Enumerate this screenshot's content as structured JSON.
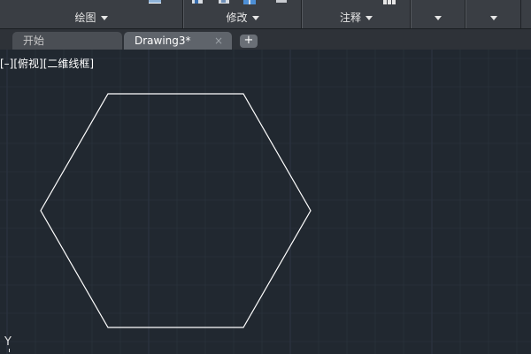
{
  "ribbon": {
    "panels": [
      {
        "label": "绘图",
        "has_dropdown": true
      },
      {
        "label": "修改",
        "has_dropdown": true
      },
      {
        "label": "注释",
        "has_dropdown": true
      },
      {
        "label": "",
        "has_dropdown": true
      },
      {
        "label": "",
        "has_dropdown": true
      }
    ]
  },
  "tabs": {
    "items": [
      {
        "label": "开始",
        "active": false
      },
      {
        "label": "Drawing3*",
        "active": true,
        "close": "×"
      }
    ],
    "add": "+"
  },
  "viewport": {
    "label": "[–][俯视][二维线框]",
    "ucs_axis": "Y",
    "grid_color": "#2c3440",
    "background": "#212830"
  },
  "drawing": {
    "shape": "hexagon",
    "stroke_color": "#ffffff"
  },
  "colors": {
    "ribbon_bg": "#3a3e44",
    "tab_active": "#5f646b",
    "tab_inactive": "#4a4e54"
  }
}
